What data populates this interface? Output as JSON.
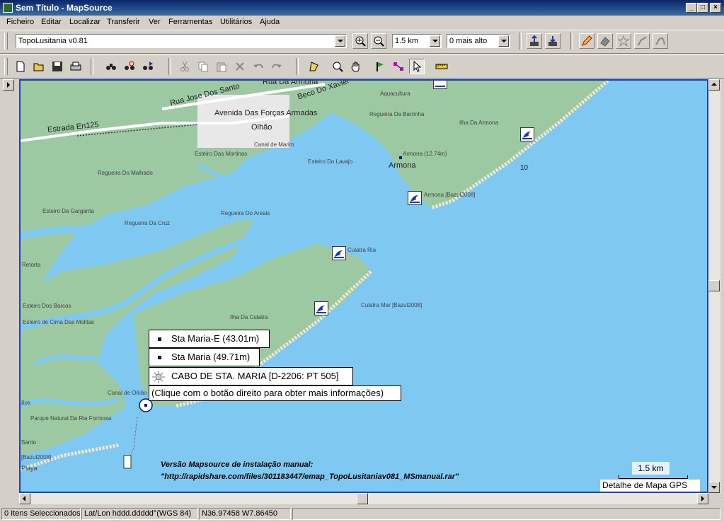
{
  "window": {
    "title": "Sem Título - MapSource"
  },
  "menu": {
    "items": [
      "Ficheiro",
      "Editar",
      "Localizar",
      "Transferir",
      "Ver",
      "Ferramentas",
      "Utilitários",
      "Ajuda"
    ]
  },
  "toolbar": {
    "map_product": "TopoLusitania v0.81",
    "zoom_scale": "1.5 km",
    "detail_level": "0 mais alto"
  },
  "map": {
    "labels": {
      "rua_armona": "Rua Da Armona",
      "rua_jose": "Rua Jose Dos Santo",
      "beco": "Beco Do Xavier",
      "aquacultura": "Aquacultura",
      "avenida": "Avenida Das Forças Armadas",
      "estrada": "Estrada En125",
      "olhao": "Olhão",
      "regueira_barrinha": "Regueira Da Barrinha",
      "ilha_armona": "Ilha Da Armona",
      "canal_marim": "Canal de Marim",
      "esteiro_mortinas": "Esteiro Das Mortinas",
      "esteiro_lavajo": "Esteiro Do Lavajo",
      "armona_poi": "Armona (12.74m)",
      "armona": "Armona",
      "depth_10": "10",
      "regueira_malhado": "Regueira Do Malhado",
      "armona_bazul": "Armona [Bazul2008]",
      "esteiro_garganta": "Esteiro Da Garganta",
      "regueira_areais": "Regueira Do Areais",
      "regueira_cruz": "Regueira Da Cruz",
      "culatra_ria": "Culatra Ria",
      "retorta": "Retorta",
      "esteiro_barcos": "Esteiro Dos Barcos",
      "culatra_mar": "Culatra Mar [Bazul2008]",
      "ilha_culatra": "Ilha Da Culatra",
      "esteiro_molitas": "Esteiro de Cima Das Molitas",
      "canal_olhao": "Canal de Olhão",
      "aos": "ãos",
      "parque": "Parque Natural Da Ria Formosa",
      "santo": "Santo",
      "bazul_left": "[Bazul2008]",
      "playa": "Playa"
    },
    "tooltip": {
      "line1": "Sta Maria-E (43.01m)",
      "line2": "Sta Maria (49.71m)",
      "line3": "CABO DE STA. MARIA [D-2206: PT 505]",
      "hint": "(Clique com o botão direito para obter mais informações)"
    },
    "watermark": {
      "line1": "Versão Mapsource de instalação manual:",
      "line2": "\"http://rapidshare.com/files/301183447/emap_TopoLusitaniav081_MSmanual.rar\""
    },
    "scale_label": "1.5 km",
    "detail_label": "Detalhe de Mapa GPS"
  },
  "status": {
    "selected": "0 Itens Seleccionados",
    "format": "Lat/Lon hddd.ddddd°(WGS 84)",
    "coords": "N36.97458 W7.86450"
  },
  "colors": {
    "water": "#7ec8f2",
    "land": "#9cc9a2",
    "map_border": "#1f3fbf",
    "title_bar": "#0a246a"
  }
}
